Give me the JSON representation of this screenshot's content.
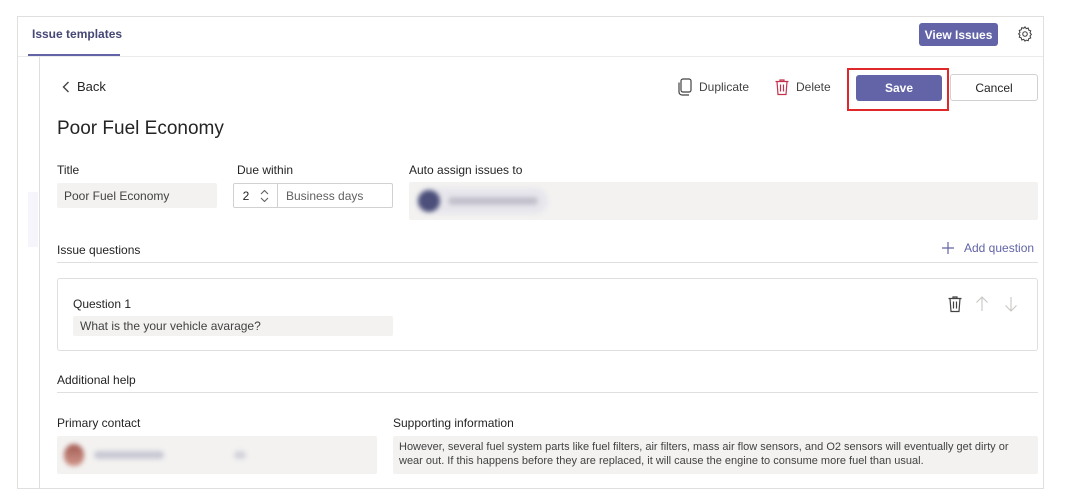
{
  "tab": {
    "label": "Issue templates"
  },
  "header": {
    "view_issues_label": "View Issues"
  },
  "toolbar": {
    "back_label": "Back",
    "duplicate_label": "Duplicate",
    "delete_label": "Delete",
    "save_label": "Save",
    "cancel_label": "Cancel"
  },
  "page": {
    "title": "Poor Fuel Economy"
  },
  "form": {
    "title_label": "Title",
    "title_value": "Poor Fuel Economy",
    "due_label": "Due within",
    "due_value": "2",
    "due_unit": "Business days",
    "assign_label": "Auto assign issues to"
  },
  "questions": {
    "section_label": "Issue questions",
    "add_label": "Add question",
    "items": [
      {
        "label": "Question 1",
        "value": "What is the your vehicle avarage?"
      }
    ]
  },
  "help": {
    "section_label": "Additional help",
    "primary_contact_label": "Primary contact",
    "supporting_label": "Supporting information",
    "supporting_value": "However, several fuel system parts like fuel filters, air filters, mass air flow sensors, and O2 sensors will eventually get dirty or wear out. If this happens before they are replaced, it will cause the engine to consume more fuel than usual."
  },
  "colors": {
    "accent": "#6264a7",
    "highlight": "#e0282b",
    "field_bg": "#f3f2f1"
  },
  "icons": {
    "gear": "gear-icon",
    "back": "chevron-left-icon",
    "duplicate": "copy-icon",
    "delete": "trash-icon",
    "add": "plus-icon",
    "up": "arrow-up-icon",
    "down": "arrow-down-icon"
  }
}
